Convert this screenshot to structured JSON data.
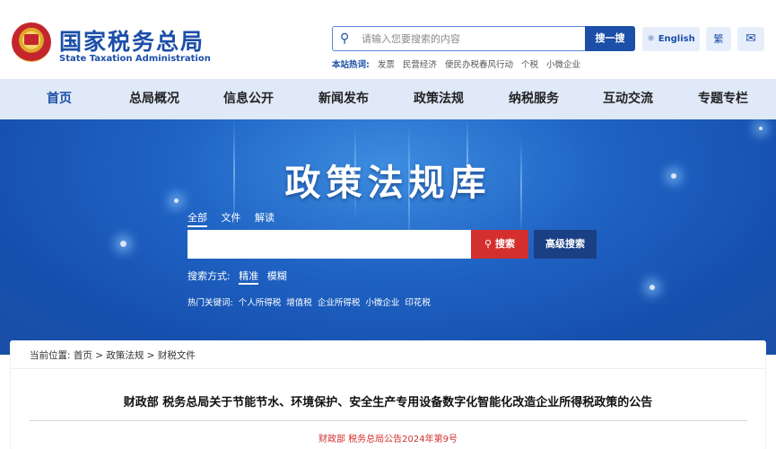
{
  "header": {
    "site_name_cn": "国家税务总局",
    "site_name_en": "State Taxation Administration",
    "search_placeholder": "请输入您要搜索的内容",
    "search_button": "搜一搜",
    "hotwords_label": "本站热词:",
    "hotwords": [
      "发票",
      "民营经济",
      "便民办税春风行动",
      "个税",
      "小微企业"
    ],
    "lang_button": "English",
    "traditional_button": "繁"
  },
  "nav": {
    "items": [
      "首页",
      "总局概况",
      "信息公开",
      "新闻发布",
      "政策法规",
      "纳税服务",
      "互动交流",
      "专题专栏"
    ],
    "active": "首页"
  },
  "banner": {
    "title": "政策法规库",
    "scope_tabs": [
      "全部",
      "文件",
      "解读"
    ],
    "search_button": "搜索",
    "advanced_button": "高级搜索",
    "mode_label": "搜索方式:",
    "modes": [
      "精准",
      "模糊"
    ],
    "keywords_label": "热门关键词:",
    "keywords": [
      "个人所得税",
      "增值税",
      "企业所得税",
      "小微企业",
      "印花税"
    ]
  },
  "content": {
    "breadcrumb": "当前位置: 首页 > 政策法规 > 财税文件",
    "doc_title": "财政部 税务总局关于节能节水、环境保护、安全生产专用设备数字化智能化改造企业所得税政策的公告",
    "doc_number": "财政部 税务总局公告2024年第9号"
  },
  "colors": {
    "brand_blue": "#1b4fa8",
    "nav_bg": "#dfe9f8",
    "search_red": "#d32f2f"
  }
}
